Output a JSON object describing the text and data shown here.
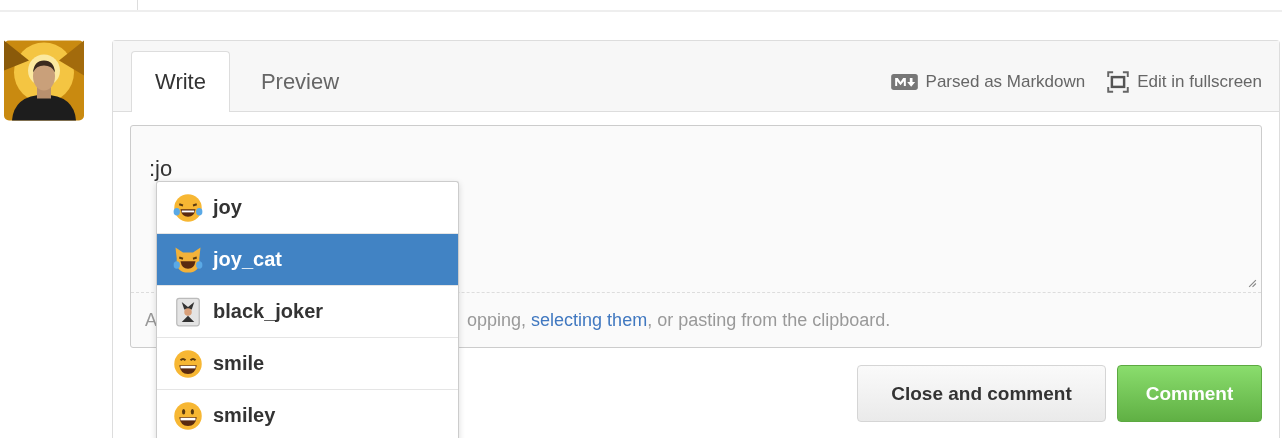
{
  "tabs": [
    {
      "label": "Write",
      "selected": true
    },
    {
      "label": "Preview",
      "selected": false
    }
  ],
  "toolbar": [
    {
      "kind": "markdown",
      "label": "Parsed as Markdown"
    },
    {
      "kind": "fullscreen",
      "label": "Edit in fullscreen"
    }
  ],
  "editor": {
    "value": ":jo"
  },
  "suggestions": [
    {
      "kind": "joy",
      "label": "joy",
      "selected": false
    },
    {
      "kind": "cat",
      "label": "joy_cat",
      "selected": true
    },
    {
      "kind": "joker",
      "label": "black_joker",
      "selected": false
    },
    {
      "kind": "smile",
      "label": "smile",
      "selected": false
    },
    {
      "kind": "smiley",
      "label": "smiley",
      "selected": false
    }
  ],
  "footer": {
    "lead": "A",
    "before": "opping, ",
    "link": "selecting them",
    "after": ", or pasting from the clipboard."
  },
  "buttons": [
    {
      "kind": "secondary",
      "label": "Close and comment"
    },
    {
      "kind": "primary",
      "label": "Comment"
    }
  ]
}
